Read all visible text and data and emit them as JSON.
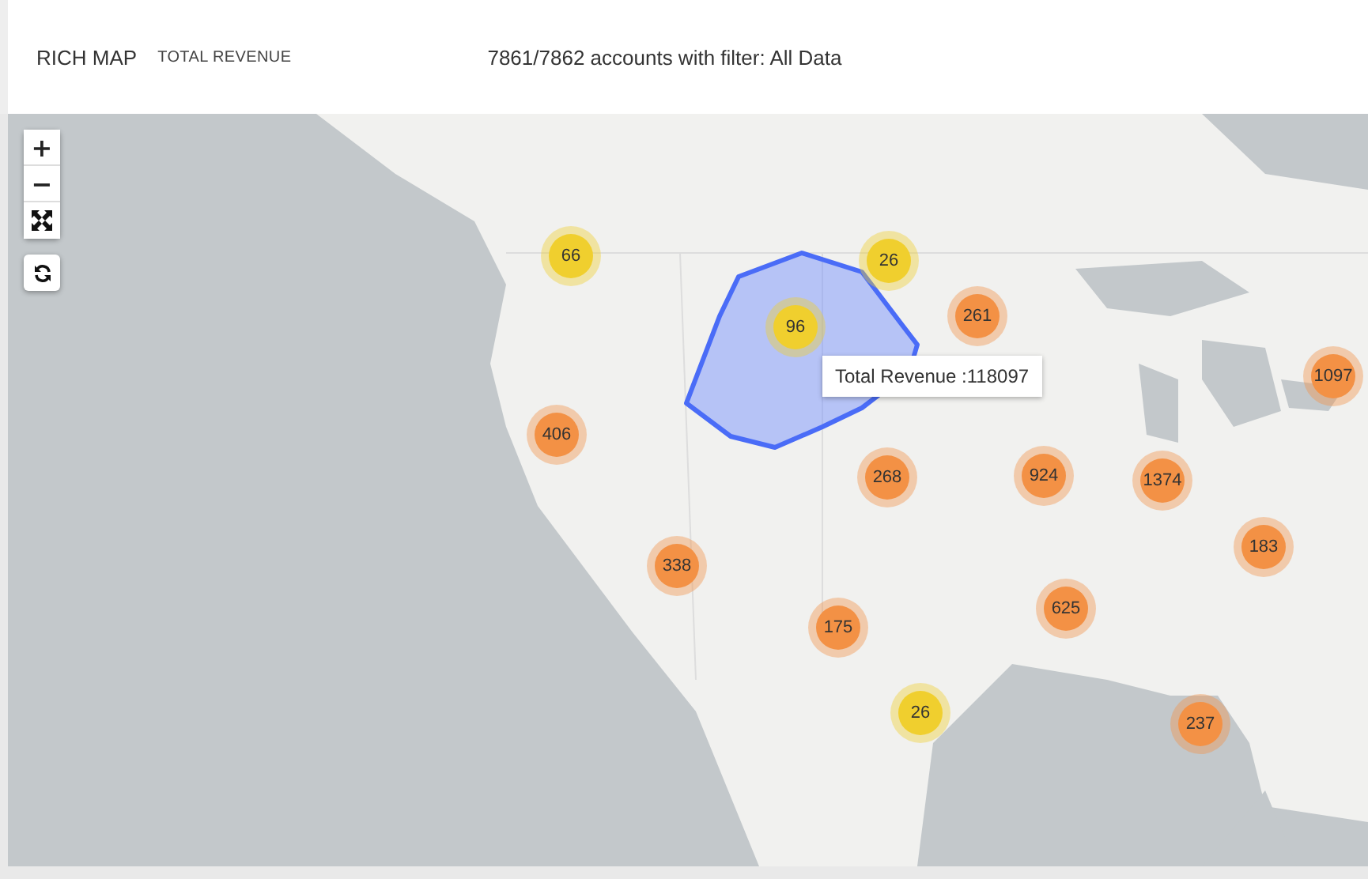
{
  "header": {
    "title": "RICH MAP",
    "subtitle": "TOTAL REVENUE",
    "filter_summary": "7861/7862 accounts with filter: All Data"
  },
  "map_controls": {
    "zoom_in": "+",
    "zoom_out": "−"
  },
  "clusters": [
    {
      "label": "66",
      "color": "#f0cf2e"
    },
    {
      "label": "26",
      "color": "#f0cf2e"
    },
    {
      "label": "96",
      "color": "#f0cf2e"
    },
    {
      "label": "261",
      "color": "#f39145"
    },
    {
      "label": "1097",
      "color": "#f39145"
    },
    {
      "label": "406",
      "color": "#f39145"
    },
    {
      "label": "268",
      "color": "#f39145"
    },
    {
      "label": "924",
      "color": "#f39145"
    },
    {
      "label": "1374",
      "color": "#f39145"
    },
    {
      "label": "338",
      "color": "#f39145"
    },
    {
      "label": "183",
      "color": "#f39145"
    },
    {
      "label": "625",
      "color": "#f39145"
    },
    {
      "label": "175",
      "color": "#f39145"
    },
    {
      "label": "26",
      "color": "#f0cf2e"
    },
    {
      "label": "237",
      "color": "#f39145"
    }
  ],
  "tooltip": {
    "text": "Total Revenue :118097"
  }
}
